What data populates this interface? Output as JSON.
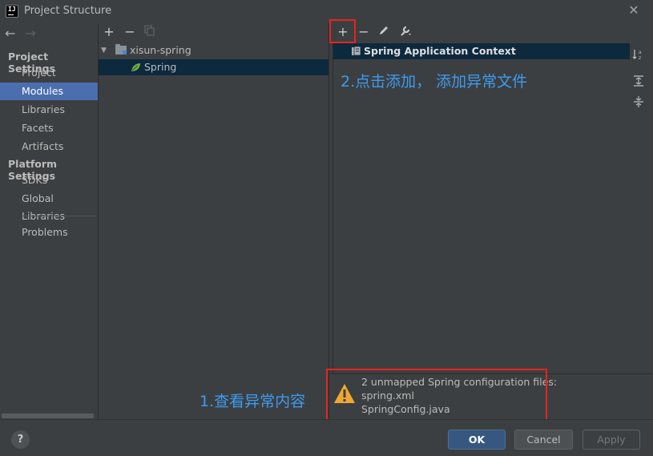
{
  "window": {
    "title": "Project Structure",
    "logo_text": "IJ"
  },
  "sidebar": {
    "project_settings_header": "Project Settings",
    "platform_settings_header": "Platform Settings",
    "items": [
      {
        "label": "Project"
      },
      {
        "label": "Modules",
        "selected": true
      },
      {
        "label": "Libraries"
      },
      {
        "label": "Facets"
      },
      {
        "label": "Artifacts"
      },
      {
        "label": "SDKs"
      },
      {
        "label": "Global Libraries"
      },
      {
        "label": "Problems"
      }
    ]
  },
  "module_tree": {
    "toolbar": [
      "add-icon",
      "remove-icon",
      "copy-icon"
    ],
    "nodes": [
      {
        "label": "xisun-spring",
        "type": "module",
        "expanded": true
      },
      {
        "label": "Spring",
        "type": "facet",
        "selected": true
      }
    ]
  },
  "context_panel": {
    "toolbar": [
      "add-icon",
      "remove-icon",
      "edit-icon",
      "wrench-icon"
    ],
    "items": [
      {
        "label": "Spring Application Context"
      }
    ],
    "side_tools": [
      "sort-alpha-icon",
      "expand-all-icon",
      "collapse-all-icon"
    ]
  },
  "annotations": {
    "step2": "2.点击添加， 添加异常文件",
    "step1": "1.查看异常内容",
    "highlight_color": "#e8231f",
    "text_color": "#3d9bf0"
  },
  "warning": {
    "line1": "2 unmapped Spring configuration files:",
    "line2": "spring.xml",
    "line3": "SpringConfig.java"
  },
  "buttons": {
    "help": "?",
    "ok": "OK",
    "cancel": "Cancel",
    "apply": "Apply"
  },
  "colors": {
    "selection": "#4b6eaf",
    "tree_selection": "#0d293e",
    "spring_green": "#6db33f",
    "warning_orange": "#f0a732"
  }
}
